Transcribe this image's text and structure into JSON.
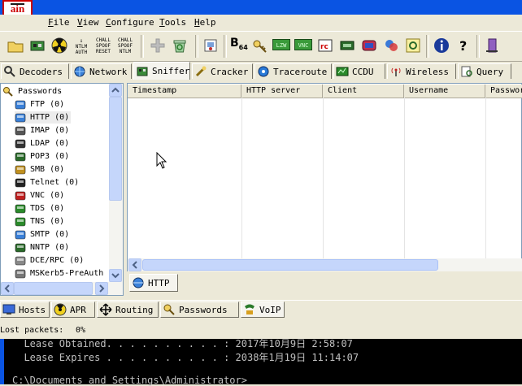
{
  "app": {
    "logo_text": "ain"
  },
  "menu": [
    {
      "mnemonic": "F",
      "rest": "ile"
    },
    {
      "mnemonic": "V",
      "rest": "iew"
    },
    {
      "mnemonic": "C",
      "rest": "onfigure"
    },
    {
      "mnemonic": "T",
      "rest": "ools"
    },
    {
      "mnemonic": "H",
      "rest": "elp"
    }
  ],
  "toolbar": {
    "icons": [
      "open-folder-icon",
      "network-card-icon",
      "radiation-icon",
      "ntlm-auth-icon",
      "chall-spoof-reset-icon",
      "chall-spoof-ntlm-icon",
      "add-icon",
      "recycle-icon",
      "certificate-icon",
      "base64-icon",
      "key-icon",
      "lzw-icon",
      "vnc-icon",
      "rdp-icon",
      "chip-icon",
      "cd-icon",
      "hash-icon",
      "locked-note-icon",
      "info-icon",
      "help-icon",
      "exit-icon"
    ],
    "ntlm_auth": [
      "NTLM",
      "AUTH"
    ],
    "chall_spoof_reset": [
      "CHALL",
      "SPOOF",
      "RESET"
    ],
    "chall_spoof_ntlm": [
      "CHALL",
      "SPOOF",
      "NTLM"
    ],
    "b64": "B",
    "b64_sub": "64",
    "lzw": "LZW",
    "vnc": "VNC"
  },
  "top_tabs": [
    "Decoders",
    "Network",
    "Sniffer",
    "Cracker",
    "Traceroute",
    "CCDU",
    "Wireless",
    "Query"
  ],
  "tree": {
    "root": "Passwords",
    "items": [
      {
        "label": "FTP",
        "count": "(0)"
      },
      {
        "label": "HTTP",
        "count": "(0)"
      },
      {
        "label": "IMAP",
        "count": "(0)"
      },
      {
        "label": "LDAP",
        "count": "(0)"
      },
      {
        "label": "POP3",
        "count": "(0)"
      },
      {
        "label": "SMB",
        "count": "(0)"
      },
      {
        "label": "Telnet",
        "count": "(0)"
      },
      {
        "label": "VNC",
        "count": "(0)"
      },
      {
        "label": "TDS",
        "count": "(0)"
      },
      {
        "label": "TNS",
        "count": "(0)"
      },
      {
        "label": "SMTP",
        "count": "(0)"
      },
      {
        "label": "NNTP",
        "count": "(0)"
      },
      {
        "label": "DCE/RPC",
        "count": "(0)"
      },
      {
        "label": "MSKerb5-PreAuth",
        "count": ""
      }
    ]
  },
  "grid": {
    "columns": [
      "Timestamp",
      "HTTP server",
      "Client",
      "Username",
      "Passwor"
    ]
  },
  "sub_tab": "HTTP",
  "bottom_tabs": [
    "Hosts",
    "APR",
    "Routing",
    "Passwords",
    "VoIP"
  ],
  "status": {
    "label": "Lost packets:",
    "value": "0%"
  },
  "console": {
    "line1": "  Lease Obtained. . . . . . . . . . : 2017年10月9日 2:58:07",
    "line2": "  Lease Expires . . . . . . . . . . : 2038年1月19日 11:14:07",
    "line3": "C:\\Documents and Settings\\Administrator>"
  }
}
